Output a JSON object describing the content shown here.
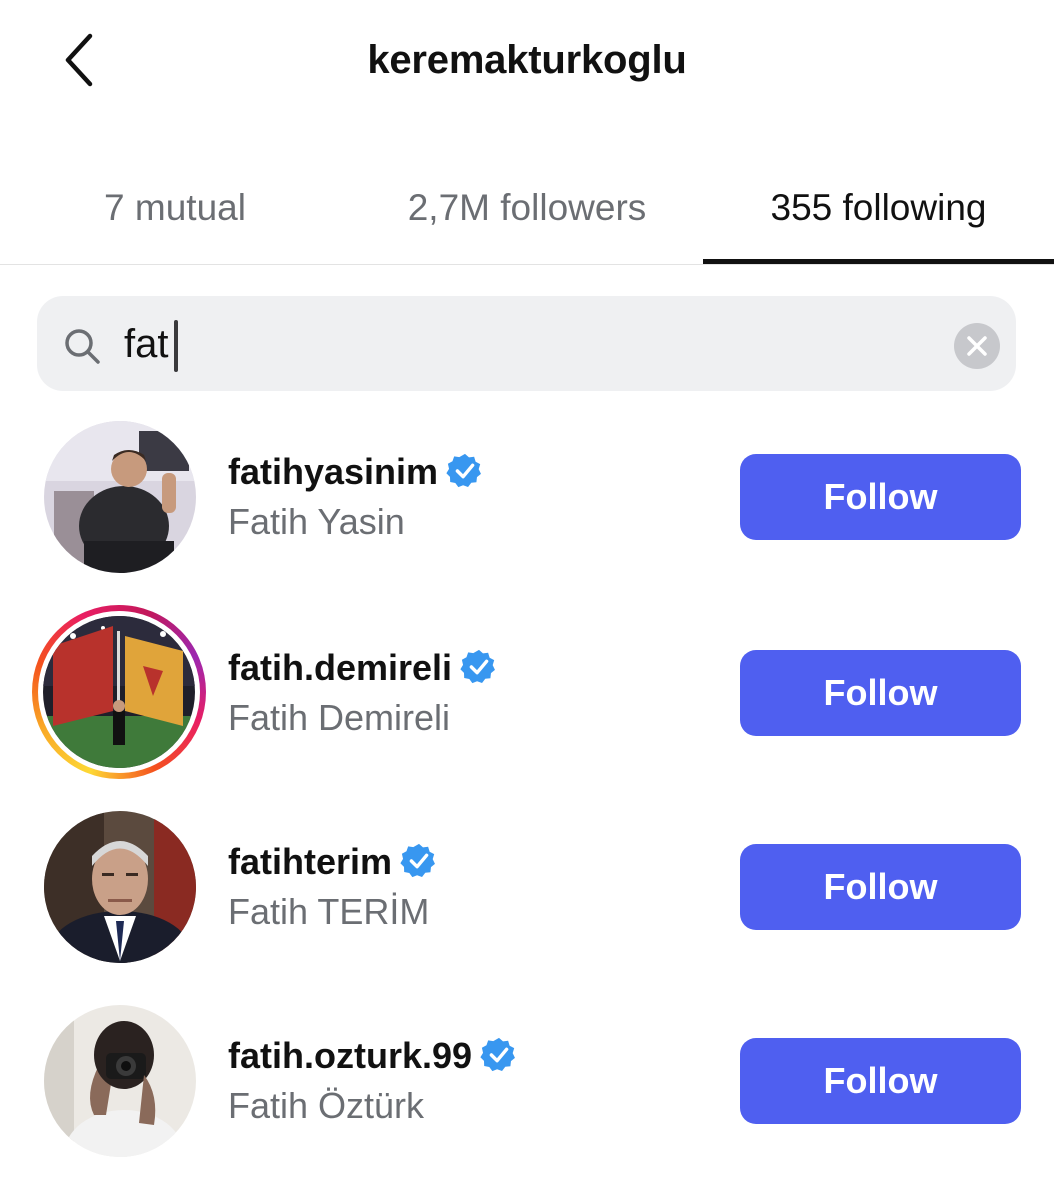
{
  "header": {
    "title": "keremakturkoglu",
    "back_icon": "chevron-left-icon"
  },
  "tabs": [
    {
      "label": "7 mutual",
      "active": false
    },
    {
      "label": "2,7M followers",
      "active": false
    },
    {
      "label": "355 following",
      "active": true
    }
  ],
  "search": {
    "value": "fat",
    "icon": "search-icon",
    "clear_icon": "clear-circle-icon"
  },
  "colors": {
    "accent": "#4f5ff0",
    "verified": "#3897f0",
    "muted_text": "#6b6e73",
    "search_bg": "#eff0f2"
  },
  "results": [
    {
      "username": "fatihyasinim",
      "full_name": "Fatih Yasin",
      "verified": true,
      "has_story": false,
      "button": "Follow"
    },
    {
      "username": "fatih.demireli",
      "full_name": "Fatih Demireli",
      "verified": true,
      "has_story": true,
      "button": "Follow"
    },
    {
      "username": "fatihterim",
      "full_name": "Fatih TERİM",
      "verified": true,
      "has_story": false,
      "button": "Follow"
    },
    {
      "username": "fatih.ozturk.99",
      "full_name": "Fatih Öztürk",
      "verified": true,
      "has_story": false,
      "button": "Follow"
    }
  ]
}
